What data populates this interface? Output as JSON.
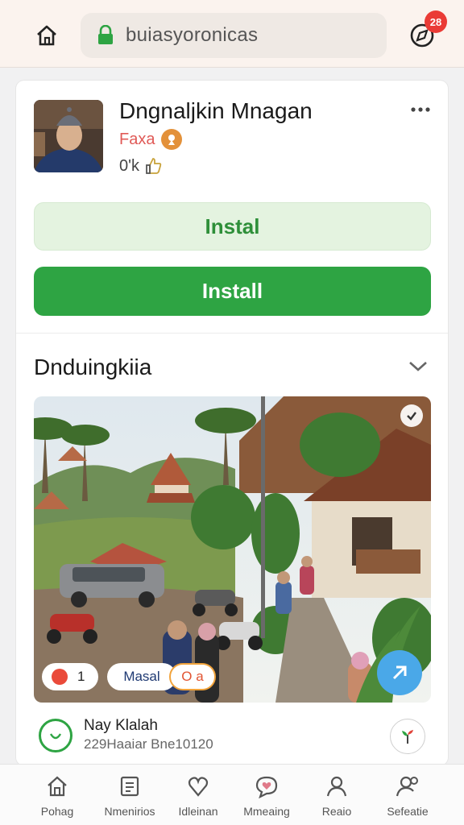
{
  "browser": {
    "url": "buiasyoronicas",
    "notification_count": "28",
    "icons": {
      "home": "home-icon",
      "lock": "lock-icon",
      "compass": "compass-icon"
    }
  },
  "app": {
    "title": "Dngnaljkin Mnagan",
    "tag": "Faxa",
    "count": "0'k",
    "install_light_label": "Instal",
    "install_label": "Install"
  },
  "section": {
    "title": "Dnduingkiia"
  },
  "photo_chips": {
    "count": "1",
    "label": "Masal",
    "tag": "O a"
  },
  "user": {
    "name": "Nay Klalah",
    "subtitle": "229Haaiar Bne10120"
  },
  "nav": {
    "items": [
      {
        "label": "Pohag",
        "icon": "home-icon"
      },
      {
        "label": "Nmenirios",
        "icon": "clipboard-icon"
      },
      {
        "label": "Idleinan",
        "icon": "heart-icon"
      },
      {
        "label": "Mmeaing",
        "icon": "chat-heart-icon"
      },
      {
        "label": "Reaio",
        "icon": "person-icon"
      },
      {
        "label": "Sefeatie",
        "icon": "profile-settings-icon"
      }
    ]
  },
  "colors": {
    "accent_green": "#2ea443",
    "light_green": "#e4f3e0",
    "badge_red": "#ea3b36",
    "fab_blue": "#4aa8e8"
  }
}
